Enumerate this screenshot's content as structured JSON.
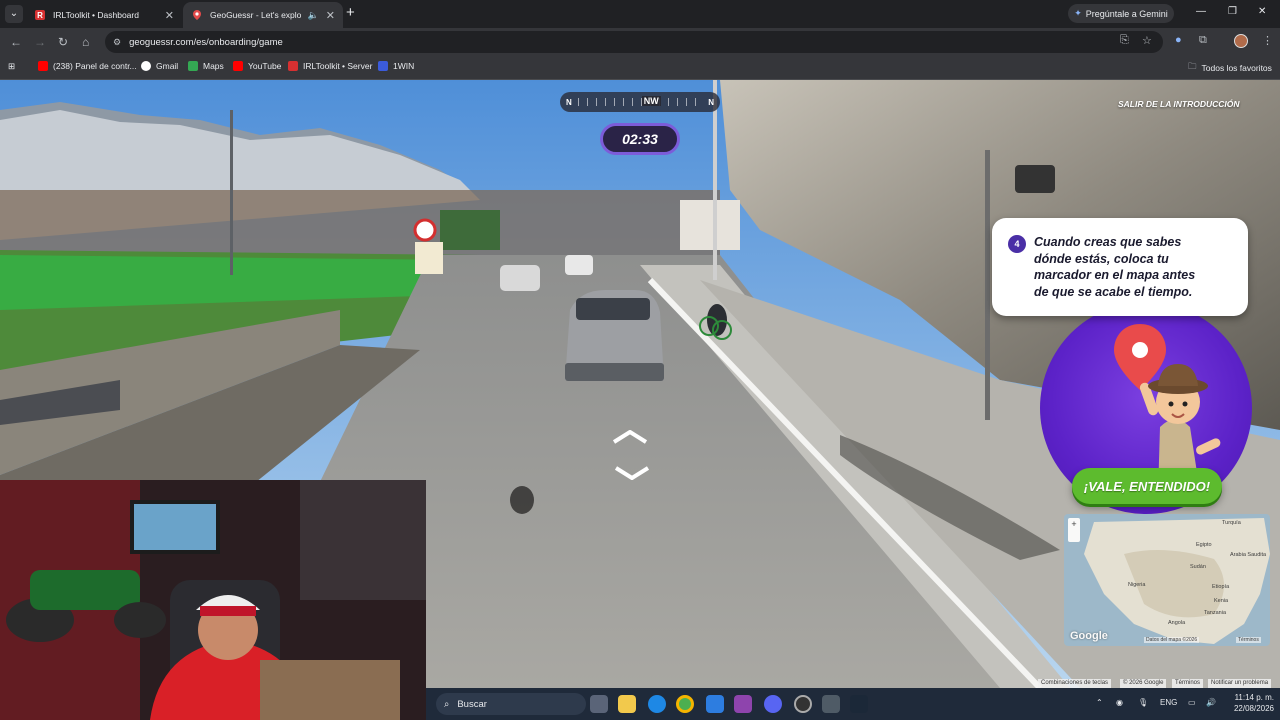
{
  "browser": {
    "tabs": [
      {
        "title": "IRLToolkit • Dashboard",
        "active": false
      },
      {
        "title": "GeoGuessr - Let's explore the world!",
        "active": true
      }
    ],
    "new_tab": "+",
    "gemini_label": "Pregúntale a Gemini",
    "window_controls": {
      "minimize": "—",
      "restore": "❐",
      "close": "✕"
    },
    "url": "geoguessr.com/es/onboarding/game",
    "bookmarks": [
      {
        "label": "(238) Panel de contr...",
        "icon": "youtube-icon"
      },
      {
        "label": "Gmail",
        "icon": "google-icon"
      },
      {
        "label": "Maps",
        "icon": "maps-icon"
      },
      {
        "label": "YouTube",
        "icon": "youtube-icon"
      },
      {
        "label": "IRLToolkit • Server",
        "icon": "irltoolkit-icon"
      },
      {
        "label": "1WIN",
        "icon": "1win-icon"
      }
    ],
    "all_favorites": "Todos los favoritos"
  },
  "game": {
    "compass": {
      "left": "N",
      "center": "NW",
      "right": "N"
    },
    "timer": "02:33",
    "exit_label": "SALIR DE LA INTRODUCCIÓN",
    "tutorial": {
      "step": "4",
      "lines": [
        "Cuando creas que sabes",
        "dónde estás, coloca tu",
        "marcador en el mapa antes",
        "de que se acabe el tiempo."
      ]
    },
    "ok_button": "¡VALE, ENTENDIDO!",
    "minimap": {
      "google": "Google",
      "zoom_in": "+",
      "map_data": "Datos del mapa ©2026",
      "terms": "Términos",
      "labels": [
        "Turquía",
        "Egipto",
        "Arabia Saudita",
        "Sudán",
        "Etiopía",
        "Nigeria",
        "Kenia",
        "Tanzania",
        "Angola"
      ]
    },
    "attribution": {
      "shortcuts": "Combinaciones de teclas",
      "copyright": "© 2026 Google",
      "terms": "Términos",
      "report": "Notificar un problema"
    }
  },
  "taskbar": {
    "search_label": "Buscar",
    "tray_lang": "ENG",
    "time": "11:14 p. m.",
    "date": "22/08/2026"
  },
  "colors": {
    "accent_purple": "#5c22c8",
    "ok_green": "#5dbb2e",
    "timer_border": "#7c5cd9"
  }
}
